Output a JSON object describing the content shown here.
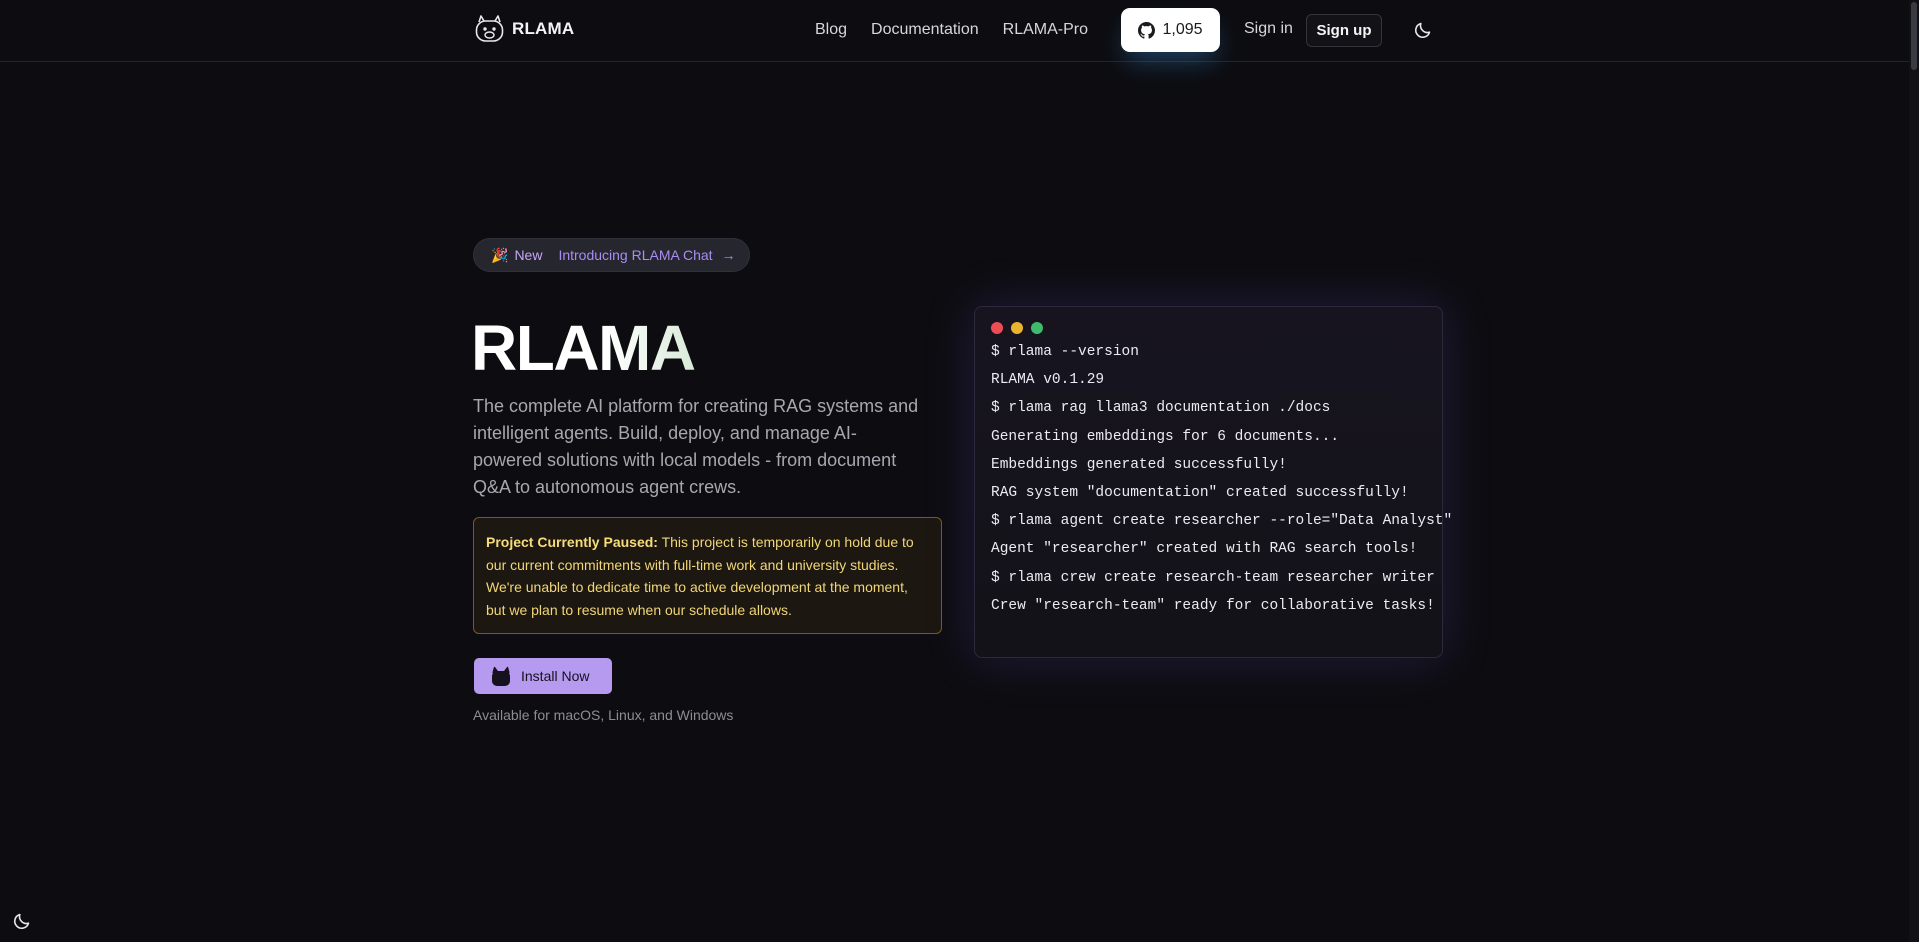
{
  "header": {
    "logo_text": "RLAMA",
    "nav": [
      {
        "label": "Blog"
      },
      {
        "label": "Documentation"
      },
      {
        "label": "RLAMA-Pro"
      }
    ],
    "github_stars": "1,095",
    "signin_label": "Sign in",
    "signup_label": "Sign up",
    "theme_icon": "moon-icon"
  },
  "announcement": {
    "emoji": "🎉",
    "badge": "New",
    "text": "Introducing RLAMA Chat",
    "arrow": "→"
  },
  "hero": {
    "title": "RLAMA",
    "description": "The complete AI platform for creating RAG systems and intelligent agents. Build, deploy, and manage AI-powered solutions with local models - from document Q&A to autonomous agent crews."
  },
  "notice": {
    "title": "Project Currently Paused:",
    "body": " This project is temporarily on hold due to our current commitments with full-time work and university studies. We're unable to dedicate time to active development at the moment, but we plan to resume when our schedule allows."
  },
  "install": {
    "label": "Install Now",
    "available": "Available for macOS, Linux, and Windows"
  },
  "terminal": {
    "lines": [
      "$ rlama --version",
      "RLAMA v0.1.29",
      "$ rlama rag llama3 documentation ./docs",
      "Generating embeddings for 6 documents...",
      "Embeddings generated successfully!",
      "RAG system \"documentation\" created successfully!",
      "$ rlama agent create researcher --role=\"Data Analyst\"",
      "Agent \"researcher\" created with RAG search tools!",
      "$ rlama crew create research-team researcher writer",
      "Crew \"research-team\" ready for collaborative tasks!"
    ]
  },
  "colors": {
    "background": "#0d0d11",
    "accent": "#b69af0",
    "notice_text": "#f1d676",
    "notice_border": "#7a5a18"
  }
}
